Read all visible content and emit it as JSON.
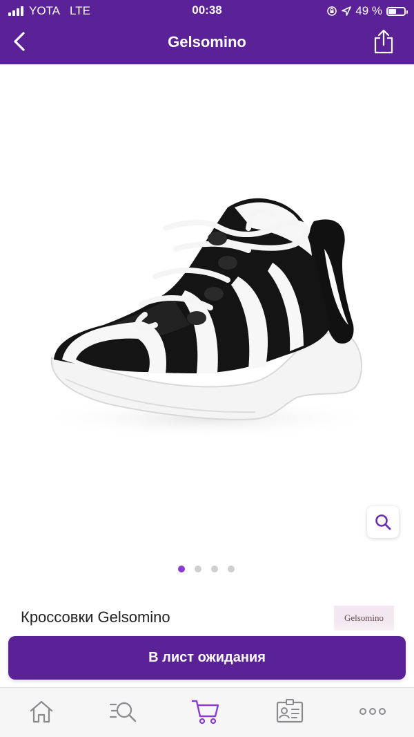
{
  "status_bar": {
    "carrier": "YOTA",
    "network": "LTE",
    "time": "00:38",
    "battery_text": "49 %",
    "battery_level": 0.49
  },
  "nav": {
    "title": "Gelsomino",
    "back_icon": "chevron-left-icon",
    "share_icon": "share-icon"
  },
  "gallery": {
    "image_count": 4,
    "active_index": 0,
    "zoom_icon": "search-icon"
  },
  "product": {
    "name": "Кроссовки Gelsomino",
    "brand_logo_text": "Gelsomino"
  },
  "actions": {
    "waitlist_label": "В лист ожидания"
  },
  "tab_bar": {
    "items": [
      "home-icon",
      "search-list-icon",
      "cart-icon",
      "profile-card-icon",
      "more-icon"
    ],
    "active": "cart-icon"
  },
  "colors": {
    "brand": "#5b2297",
    "accent": "#8a3ad0",
    "dot_inactive": "#cfcfcf"
  }
}
